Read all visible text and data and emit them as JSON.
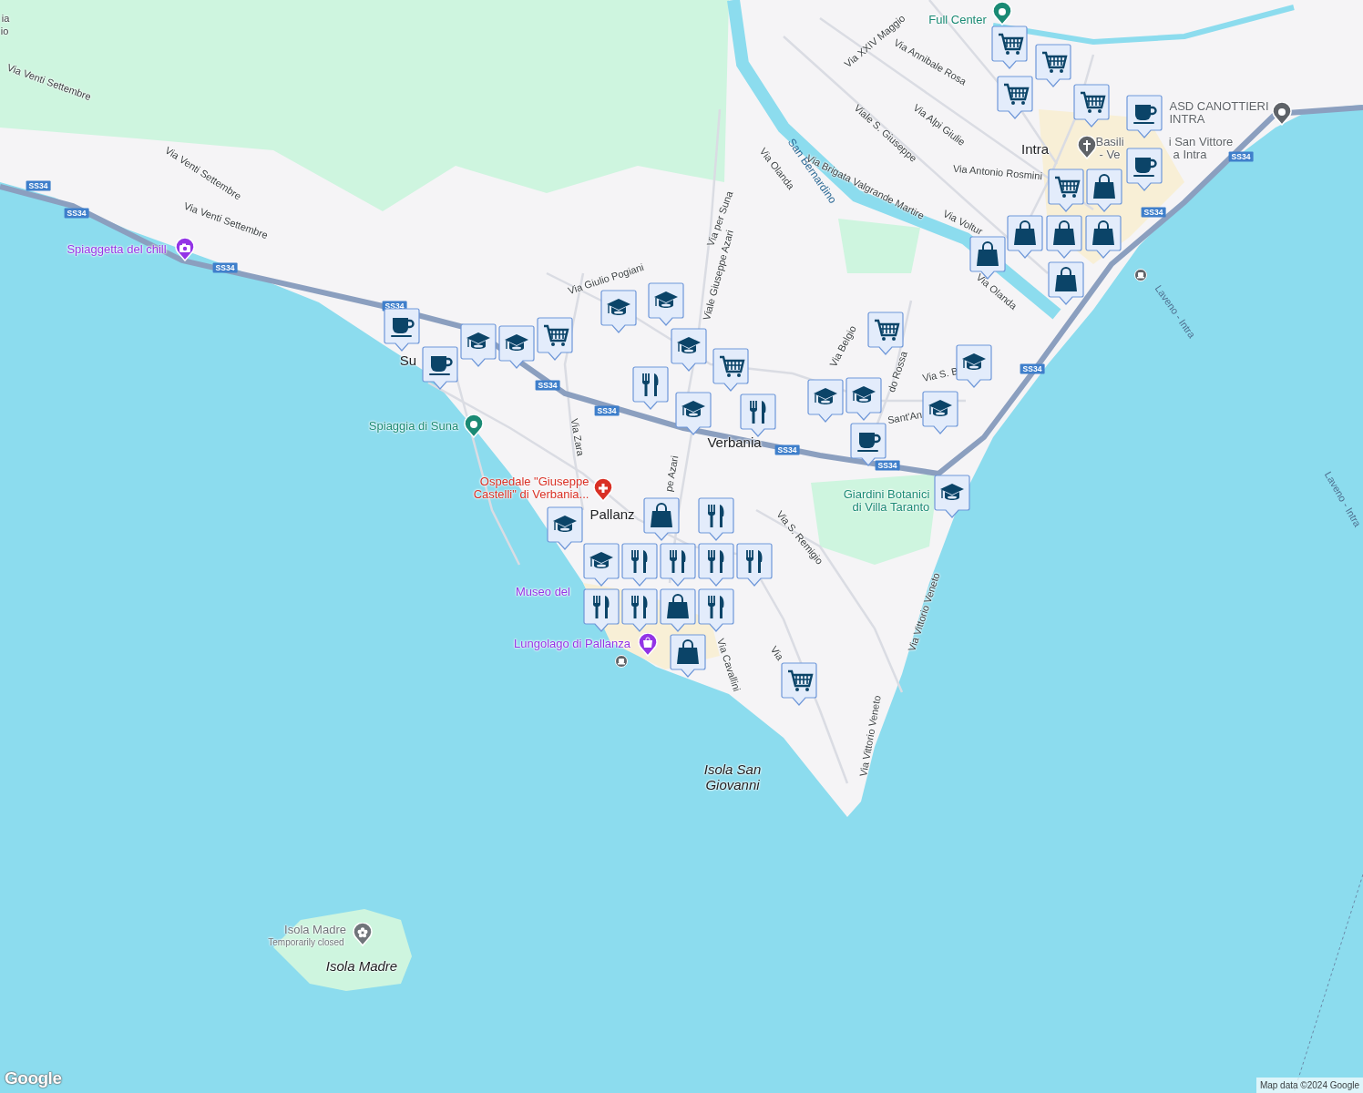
{
  "map": {
    "labels": [
      {
        "kind": "street",
        "text": "ia"
      },
      {
        "kind": "street",
        "text": "io"
      },
      {
        "kind": "street",
        "text": "Via Venti Settembre"
      },
      {
        "kind": "poi",
        "text": "Full Center",
        "color": "#1a8a74"
      },
      {
        "kind": "street",
        "text": "Via XXIV Maggio"
      },
      {
        "kind": "street",
        "text": "Via Annibale Rosa"
      },
      {
        "kind": "street",
        "text": "Viale S. Giuseppe"
      },
      {
        "kind": "street",
        "text": "Via Alpi Giulie"
      },
      {
        "kind": "poi",
        "text": "ASD CANOTTIERI\nINTRA",
        "color": "#5f6368"
      },
      {
        "kind": "town",
        "text": "Intra"
      },
      {
        "kind": "poi",
        "text": "Basili",
        "color": "#5f6368"
      },
      {
        "kind": "poi",
        "text": "i San Vittore",
        "color": "#5f6368"
      },
      {
        "kind": "poi",
        "text": "- Ve",
        "color": "#5f6368"
      },
      {
        "kind": "poi",
        "text": "a Intra",
        "color": "#5f6368"
      },
      {
        "kind": "street",
        "text": "Via Olanda"
      },
      {
        "kind": "river",
        "text": "San Bernardino"
      },
      {
        "kind": "street",
        "text": "Via Brigata Valgrande Martire"
      },
      {
        "kind": "street",
        "text": "Via Antonio Rosmini"
      },
      {
        "kind": "street",
        "text": "Via Voltur"
      },
      {
        "kind": "poi",
        "text": "Spiaggetta del chill",
        "color": "#9334e6"
      },
      {
        "kind": "street",
        "text": "Via Venti Settembre"
      },
      {
        "kind": "street",
        "text": "Via Venti Settembre"
      },
      {
        "kind": "street",
        "text": "Via per Suna"
      },
      {
        "kind": "street",
        "text": "Via Olanda"
      },
      {
        "kind": "ferry",
        "text": "Laveno - Intra"
      },
      {
        "kind": "street",
        "text": "Via Giulio Pogiani"
      },
      {
        "kind": "street",
        "text": "Viale Giuseppe Azari"
      },
      {
        "kind": "street",
        "text": "Via Belgio"
      },
      {
        "kind": "street",
        "text": "do Rossa"
      },
      {
        "kind": "street",
        "text": "Via S. B"
      },
      {
        "kind": "town",
        "text": "Su"
      },
      {
        "kind": "street",
        "text": "Sant'An"
      },
      {
        "kind": "poi",
        "text": "Spiaggia di Suna",
        "color": "#1a8a74"
      },
      {
        "kind": "street",
        "text": "Via Zara"
      },
      {
        "kind": "town",
        "text": "Verbania"
      },
      {
        "kind": "poi",
        "text": "Ospedale \"Giuseppe\nCastelli\" di Verbania...",
        "color": "#d93025"
      },
      {
        "kind": "street",
        "text": "pe Azari"
      },
      {
        "kind": "poi",
        "text": "Giardini Botanici\ndi Villa Taranto",
        "color": "#1a8a74"
      },
      {
        "kind": "street",
        "text": "Via S. Remigio"
      },
      {
        "kind": "town",
        "text": "Pallanz"
      },
      {
        "kind": "poi",
        "text": "Museo del",
        "color": "#9334e6"
      },
      {
        "kind": "poi",
        "text": "Lungolago di Pallanza",
        "color": "#9334e6"
      },
      {
        "kind": "street",
        "text": "Via Cavallini"
      },
      {
        "kind": "street",
        "text": "Via"
      },
      {
        "kind": "street",
        "text": "Via Vittorio Veneto"
      },
      {
        "kind": "street",
        "text": "Via Vittorio Veneto"
      },
      {
        "kind": "island",
        "text": "Isola San\nGiovanni"
      },
      {
        "kind": "ferry",
        "text": "Laveno - Intra"
      },
      {
        "kind": "poi",
        "text": "Isola Madre",
        "color": "#70757a"
      },
      {
        "kind": "note",
        "text": "Temporarily closed"
      },
      {
        "kind": "island",
        "text": "Isola Madre"
      }
    ],
    "shields": [
      {
        "text": "SS34"
      },
      {
        "text": "SS34"
      },
      {
        "text": "SS34"
      },
      {
        "text": "SS34"
      },
      {
        "text": "SS34"
      },
      {
        "text": "SS34"
      },
      {
        "text": "SS34"
      },
      {
        "text": "SS34"
      },
      {
        "text": "SS34"
      },
      {
        "text": "SS34"
      },
      {
        "text": "SS34"
      }
    ],
    "markers": [
      {
        "kind": "cart"
      },
      {
        "kind": "cart"
      },
      {
        "kind": "cart"
      },
      {
        "kind": "cart"
      },
      {
        "kind": "cart"
      },
      {
        "kind": "cart"
      },
      {
        "kind": "cart"
      },
      {
        "kind": "cart"
      },
      {
        "kind": "cart"
      },
      {
        "kind": "cup"
      },
      {
        "kind": "cup"
      },
      {
        "kind": "cup"
      },
      {
        "kind": "cup"
      },
      {
        "kind": "cup"
      },
      {
        "kind": "cap"
      },
      {
        "kind": "cap"
      },
      {
        "kind": "cap"
      },
      {
        "kind": "cap"
      },
      {
        "kind": "cap"
      },
      {
        "kind": "cap"
      },
      {
        "kind": "cap"
      },
      {
        "kind": "cap"
      },
      {
        "kind": "cap"
      },
      {
        "kind": "cap"
      },
      {
        "kind": "cap"
      },
      {
        "kind": "cap"
      },
      {
        "kind": "cap"
      },
      {
        "kind": "cutlery"
      },
      {
        "kind": "cutlery"
      },
      {
        "kind": "cutlery"
      },
      {
        "kind": "cutlery"
      },
      {
        "kind": "cutlery"
      },
      {
        "kind": "cutlery"
      },
      {
        "kind": "cutlery"
      },
      {
        "kind": "cutlery"
      },
      {
        "kind": "cutlery"
      },
      {
        "kind": "cutlery"
      },
      {
        "kind": "bag"
      },
      {
        "kind": "bag"
      },
      {
        "kind": "bag"
      },
      {
        "kind": "bag"
      },
      {
        "kind": "bag"
      },
      {
        "kind": "bag"
      },
      {
        "kind": "bag"
      },
      {
        "kind": "bag"
      },
      {
        "kind": "bag"
      }
    ],
    "logo": "Google",
    "attribution": "Map data ©2024 Google"
  }
}
